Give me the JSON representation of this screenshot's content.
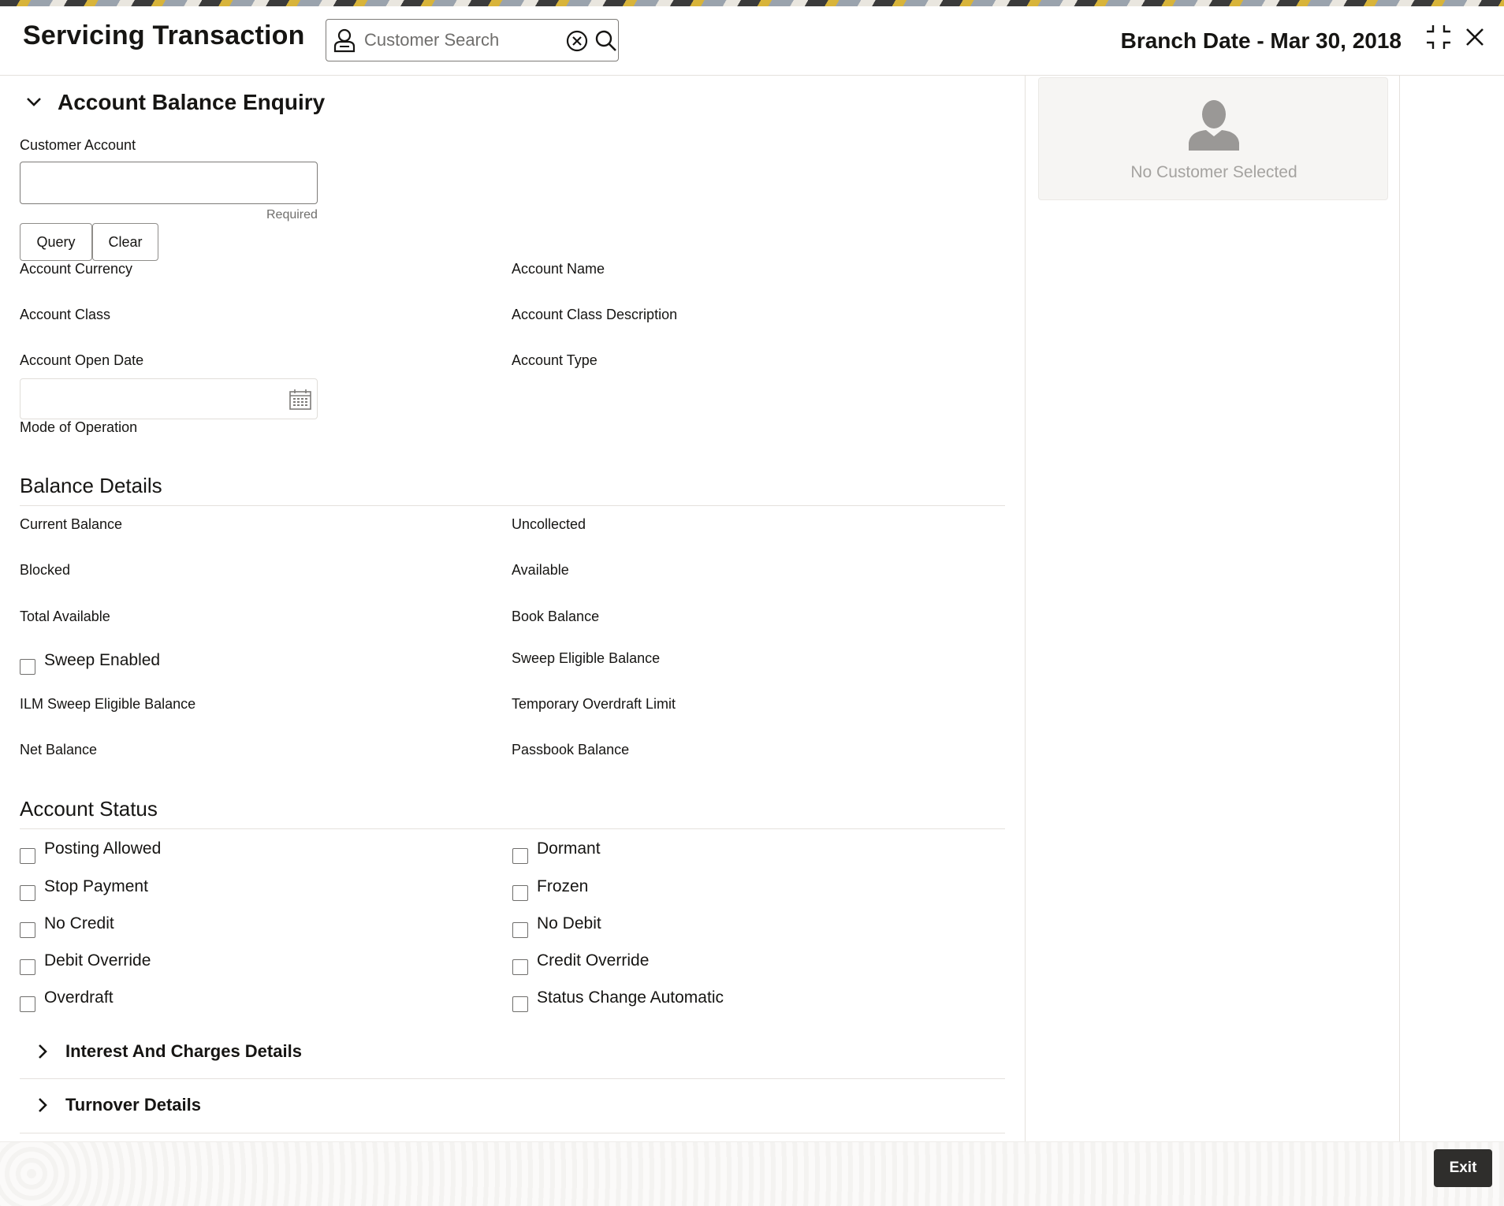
{
  "header": {
    "title": "Servicing Transaction",
    "search_placeholder": "Customer Search",
    "branch_date": "Branch Date - Mar 30, 2018"
  },
  "section": {
    "title": "Account Balance Enquiry"
  },
  "form": {
    "customer_account_label": "Customer Account",
    "customer_account_value": "",
    "required_text": "Required",
    "query_label": "Query",
    "clear_label": "Clear",
    "fields": {
      "account_currency": "Account Currency",
      "account_name": "Account Name",
      "account_class": "Account Class",
      "account_class_description": "Account Class Description",
      "account_open_date": "Account Open Date",
      "account_type": "Account Type",
      "mode_of_operation": "Mode of Operation"
    }
  },
  "balance": {
    "title": "Balance Details",
    "current_balance": "Current Balance",
    "uncollected": "Uncollected",
    "blocked": "Blocked",
    "available": "Available",
    "total_available": "Total Available",
    "book_balance": "Book Balance",
    "sweep_enabled": "Sweep Enabled",
    "sweep_eligible_balance": "Sweep Eligible Balance",
    "ilm_sweep_eligible_balance": "ILM Sweep Eligible Balance",
    "temporary_overdraft_limit": "Temporary Overdraft Limit",
    "net_balance": "Net Balance",
    "passbook_balance": "Passbook Balance"
  },
  "status": {
    "title": "Account Status",
    "posting_allowed": "Posting Allowed",
    "dormant": "Dormant",
    "stop_payment": "Stop Payment",
    "frozen": "Frozen",
    "no_credit": "No Credit",
    "no_debit": "No Debit",
    "debit_override": "Debit Override",
    "credit_override": "Credit Override",
    "overdraft": "Overdraft",
    "status_change_automatic": "Status Change Automatic"
  },
  "subsections": {
    "interest": "Interest And Charges Details",
    "turnover": "Turnover Details"
  },
  "customer_panel": {
    "empty_text": "No Customer Selected"
  },
  "footer": {
    "exit_label": "Exit"
  }
}
